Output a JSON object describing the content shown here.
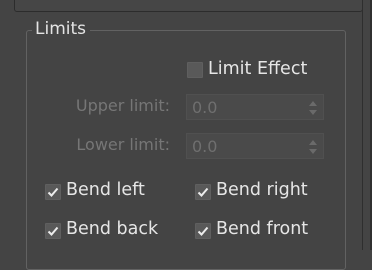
{
  "group": {
    "title": "Limits"
  },
  "limit_effect": {
    "label": "Limit Effect",
    "checked": false
  },
  "upper_limit": {
    "label": "Upper limit:",
    "value": "0.0",
    "enabled": false
  },
  "lower_limit": {
    "label": "Lower limit:",
    "value": "0.0",
    "enabled": false
  },
  "bend": {
    "left": {
      "label": "Bend left",
      "checked": true
    },
    "right": {
      "label": "Bend right",
      "checked": true
    },
    "back": {
      "label": "Bend back",
      "checked": true
    },
    "front": {
      "label": "Bend front",
      "checked": true
    }
  },
  "colors": {
    "background": "#444444",
    "text": "#e6e6e6",
    "disabled_text": "#767676",
    "checkbox_fill": "#595959"
  }
}
